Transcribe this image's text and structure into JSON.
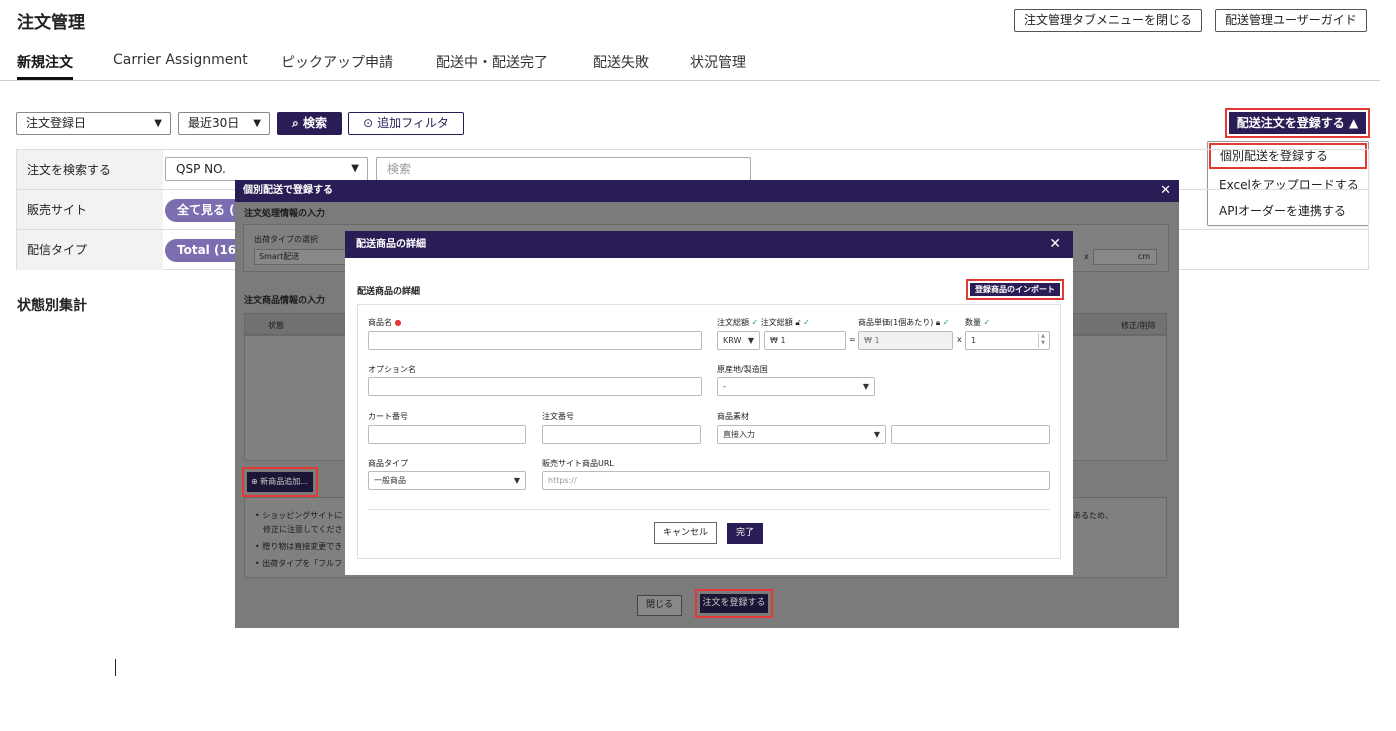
{
  "page": {
    "title": "注文管理",
    "header_buttons": [
      "注文管理タブメニューを閉じる",
      "配送管理ユーザーガイド"
    ]
  },
  "tabs": [
    {
      "label": "新規注文",
      "active": true
    },
    {
      "label": "Carrier Assignment"
    },
    {
      "label": "ピックアップ申請"
    },
    {
      "label": "配送中・配送完了"
    },
    {
      "label": "配送失敗"
    },
    {
      "label": "状況管理"
    }
  ],
  "filters": {
    "date_type": "注文登録日",
    "period": "最近30日",
    "search_label": "検索",
    "add_filter_label": "追加フィルタ"
  },
  "register": {
    "button_label": "配送注文を登録する",
    "menu": [
      "個別配送を登録する",
      "Excelをアップロードする",
      "APIオーダーを連携する"
    ]
  },
  "search_panel": {
    "rows": [
      {
        "label": "注文を検索する",
        "select": "QSP NO.",
        "placeholder": "検索"
      },
      {
        "label": "販売サイト",
        "pill": "全て見る (1"
      },
      {
        "label": "配信タイプ",
        "pill": "Total (16)"
      }
    ]
  },
  "status_summary_title": "状態別集計",
  "overlay": {
    "title": "個別配送で登録する",
    "section1": "注文処理情報の入力",
    "shipping_type_label": "出荷タイプの選択",
    "shipping_type_value": "Smart配送",
    "dim_x": "x",
    "dim_unit": "cm",
    "section2": "注文商品情報の入力",
    "col_status": "状態",
    "col_edit": "修正/削除",
    "add_product": "新商品追加...",
    "notes": [
      "• ショッピングサイトに",
      "修正に注意してくださ",
      "• 贈り物は直接変更でき",
      "• 出荷タイプを「フルフ"
    ],
    "note_right": "あるため、",
    "close_label": "閉じる",
    "register_label": "注文を登録する"
  },
  "modal": {
    "title": "配送商品の詳細",
    "subtitle": "配送商品の詳細",
    "import_label": "登録商品のインポート",
    "labels": {
      "product_name": "商品名",
      "order_amount": "注文総額",
      "order_amount2": "注文総額",
      "unit_price": "商品単価(1個あたり)",
      "quantity": "数量",
      "option_name": "オプション名",
      "origin": "原産地/製造国",
      "cart_no": "カート番号",
      "order_no": "注文番号",
      "material": "商品素材",
      "product_type": "商品タイプ",
      "site_url": "販売サイト商品URL"
    },
    "currency": "KRW",
    "currency_symbol": "₩",
    "amount": "1",
    "unit_price_value": "1",
    "quantity_value": "1",
    "eq": "=",
    "times": "x",
    "origin_value": "-",
    "material_value": "直接入力",
    "product_type_value": "一般商品",
    "url_placeholder": "https://",
    "cancel_label": "キャンセル",
    "done_label": "完了"
  }
}
